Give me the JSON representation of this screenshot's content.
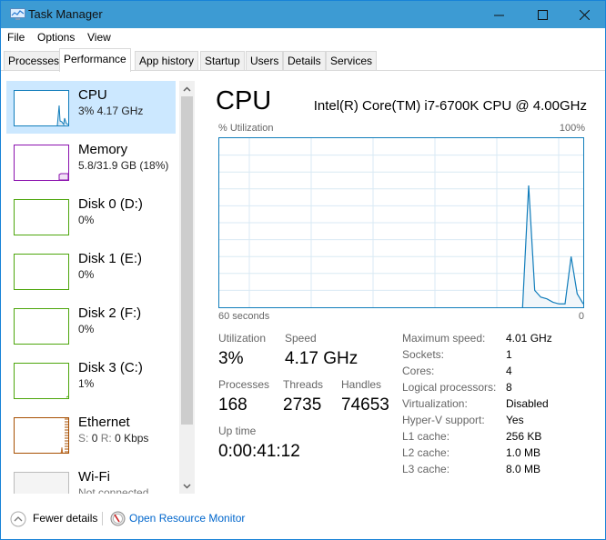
{
  "window": {
    "title": "Task Manager",
    "controls": {
      "minimize": "—",
      "maximize": "☐",
      "close": "✕"
    }
  },
  "menu": [
    "File",
    "Options",
    "View"
  ],
  "tabs": [
    {
      "label": "Processes",
      "active": false
    },
    {
      "label": "Performance",
      "active": true
    },
    {
      "label": "App history",
      "active": false
    },
    {
      "label": "Startup",
      "active": false
    },
    {
      "label": "Users",
      "active": false
    },
    {
      "label": "Details",
      "active": false
    },
    {
      "label": "Services",
      "active": false
    }
  ],
  "sidebar": {
    "items": [
      {
        "name": "CPU",
        "sub": "3%  4.17 GHz",
        "color": "#117dbb",
        "selected": true
      },
      {
        "name": "Memory",
        "sub": "5.8/31.9 GB (18%)",
        "color": "#8b12ae",
        "selected": false
      },
      {
        "name": "Disk 0 (D:)",
        "sub": "0%",
        "color": "#4da60c",
        "selected": false
      },
      {
        "name": "Disk 1 (E:)",
        "sub": "0%",
        "color": "#4da60c",
        "selected": false
      },
      {
        "name": "Disk 2 (F:)",
        "sub": "0%",
        "color": "#4da60c",
        "selected": false
      },
      {
        "name": "Disk 3 (C:)",
        "sub": "1%",
        "color": "#4da60c",
        "selected": false
      },
      {
        "name": "Ethernet",
        "sub_s_label": "S:",
        "sub_s_value": "0",
        "sub_r_label": "R:",
        "sub_r_value": "0 Kbps",
        "color": "#a74f01",
        "selected": false
      },
      {
        "name": "Wi-Fi",
        "sub": "Not connected",
        "color": "#bcbcbc",
        "selected": false
      }
    ]
  },
  "main": {
    "title": "CPU",
    "model": "Intel(R) Core(TM) i7-6700K CPU @ 4.00GHz",
    "graph": {
      "y_label": "% Utilization",
      "y_max_label": "100%",
      "x_left_label": "60 seconds",
      "x_right_label": "0",
      "line_color": "#117dbb",
      "fill_color": "#f1f6fa",
      "grid_color": "#d9eaf4"
    },
    "stats": {
      "utilization_label": "Utilization",
      "utilization_value": "3%",
      "speed_label": "Speed",
      "speed_value": "4.17 GHz",
      "processes_label": "Processes",
      "processes_value": "168",
      "threads_label": "Threads",
      "threads_value": "2735",
      "handles_label": "Handles",
      "handles_value": "74653",
      "uptime_label": "Up time",
      "uptime_value": "0:00:41:12"
    },
    "info": [
      {
        "label": "Maximum speed:",
        "value": "4.01 GHz"
      },
      {
        "label": "Sockets:",
        "value": "1"
      },
      {
        "label": "Cores:",
        "value": "4"
      },
      {
        "label": "Logical processors:",
        "value": "8"
      },
      {
        "label": "Virtualization:",
        "value": "Disabled"
      },
      {
        "label": "Hyper-V support:",
        "value": "Yes"
      },
      {
        "label": "L1 cache:",
        "value": "256 KB"
      },
      {
        "label": "L2 cache:",
        "value": "1.0 MB"
      },
      {
        "label": "L3 cache:",
        "value": "8.0 MB"
      }
    ]
  },
  "footer": {
    "fewer_details": "Fewer details",
    "open_resource_monitor": "Open Resource Monitor"
  },
  "chart_data": {
    "type": "area",
    "title": "% Utilization",
    "xlabel": "60 seconds",
    "ylabel": "% Utilization",
    "x_range": [
      60,
      0
    ],
    "ylim": [
      0,
      100
    ],
    "grid": true,
    "x": [
      60,
      57,
      54,
      51,
      48,
      45,
      42,
      39,
      36,
      33,
      30,
      27,
      24,
      21,
      18,
      15,
      12,
      10,
      9,
      8,
      7,
      6,
      5,
      4,
      3,
      2,
      1,
      0
    ],
    "values": [
      null,
      null,
      null,
      null,
      null,
      null,
      null,
      null,
      null,
      null,
      null,
      null,
      null,
      null,
      null,
      null,
      null,
      0,
      72,
      10,
      6,
      5,
      3,
      2,
      2,
      30,
      8,
      2
    ]
  }
}
